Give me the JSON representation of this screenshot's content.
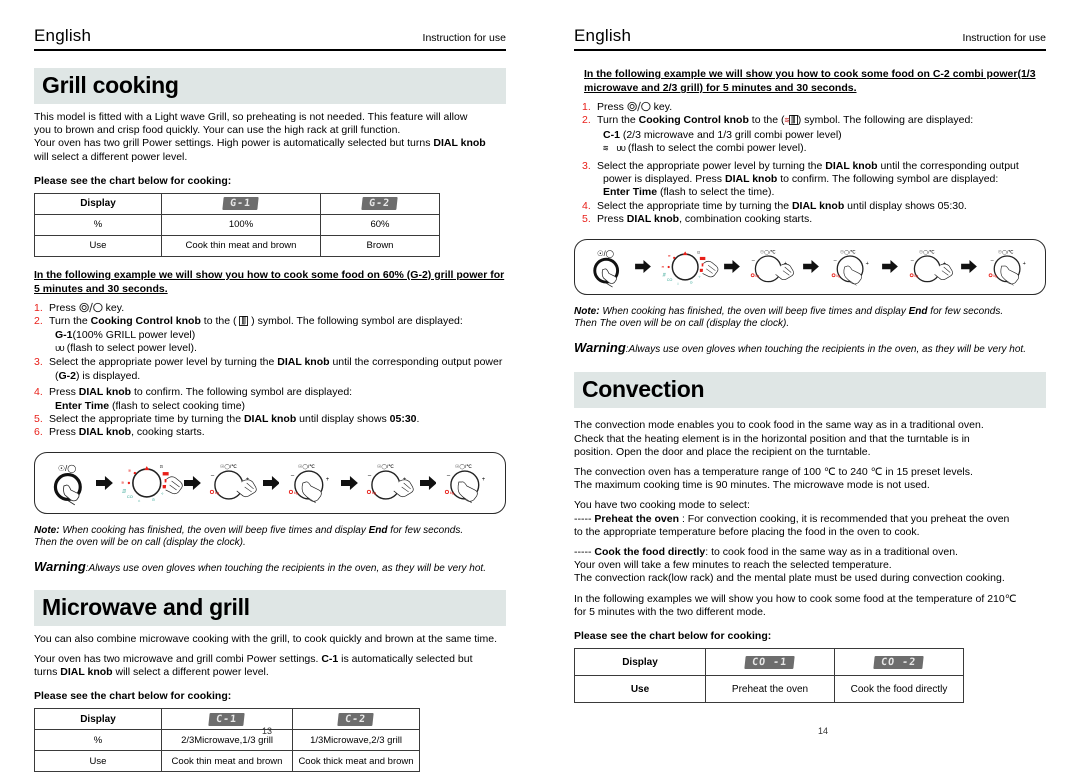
{
  "left_page": {
    "runhead": {
      "language": "English",
      "right": "Instruction for use"
    },
    "section1": {
      "title": "Grill cooking",
      "intro_lines": [
        "This model is fitted with a Light wave Grill, so preheating is not needed. This feature will allow",
        "you to brown and crisp food quickly. Your can use the high rack at grill function.",
        "Your oven has two grill Power settings. High power is automatically selected but turns DIAL knob",
        "will select a different power level."
      ],
      "chart_lead": "Please see the chart below for cooking:",
      "table": {
        "row_labels": [
          "Display",
          "%",
          "Use"
        ],
        "col1": {
          "display": "G-1",
          "percent": "100%",
          "use": "Cook thin meat and brown"
        },
        "col2": {
          "display": "G-2",
          "percent": "60%",
          "use": "Brown"
        }
      },
      "example_heading": "In the following example we will show you how to cook some food on 60% (G-2) grill power for 5 minutes and 30 seconds.",
      "example_heading_line1": "In the following example we  will show you how to  cook some food on 60% (G-2) grill power for",
      "example_heading_line2": "5 minutes and 30 seconds.",
      "steps": [
        {
          "num": "1.",
          "text": "Press  ⊚ / ◯  key."
        },
        {
          "num": "2.",
          "text": "Turn the Cooking Control knob to the  ( ∭ ) symbol. The following symbol are displayed:",
          "sub1": "G-1(100% GRILL power level)",
          "sub2": "ᴜᴜ (flash to select power level)."
        },
        {
          "num": "3.",
          "text": "Select the appropriate power  level by turning the DIAL  knob until the corresponding output power",
          "sub1": "(G-2) is displayed."
        },
        {
          "num": "4.",
          "text": "Press DIAL knob to confirm. The following symbol are  displayed:",
          "sub1": "Enter  Time  (flash to select cooking time)"
        },
        {
          "num": "5.",
          "text": "Select the appropriate time by turning the DIAL knob until display shows 05:30."
        },
        {
          "num": "6.",
          "text": "Press DIAL knob, cooking starts."
        }
      ],
      "note_line1": "Note: When cooking has finished, the  oven will beep five times  and display  End for few seconds.",
      "note_line2": "Then the oven will be  on call (display the clock).",
      "warning_label": "Warning",
      "warning_text": ":Always use oven gloves when  touching the recipients in the  oven, as they will be  very hot."
    },
    "section2": {
      "title": "Microwave and grill",
      "intro1": "You can also combine microwave cooking with the grill, to cook quickly and brown at the same time.",
      "intro2_line1": "Your oven has two microwave and grill combi Power settings. C-1 is automatically selected but",
      "intro2_line2": "turns DIAL knob  will select a different power level.",
      "chart_lead": "Please see the chart below for cooking:",
      "table": {
        "row_labels": [
          "Display",
          "%",
          "Use"
        ],
        "col1": {
          "display": "C-1",
          "percent": "2/3Microwave,1/3 grill",
          "use": "Cook thin meat and brown"
        },
        "col2": {
          "display": "C-2",
          "percent": "1/3Microwave,2/3 grill",
          "use": "Cook thick meat and brown"
        }
      }
    },
    "page_number": "13"
  },
  "right_page": {
    "runhead": {
      "language": "English",
      "right": "Instruction for use"
    },
    "example_heading_line1": "In the following example we will show you how to cook some food on C-2 combi power(1/3",
    "example_heading_line2": "microwave and 2/3 grill) for 5 minutes and 30 seconds.",
    "steps": [
      {
        "num": "1.",
        "text": "Press  ⊚ / ◯  key."
      },
      {
        "num": "2.",
        "text": "Turn the Cooking Control knob to the  ( ≋ ∭ ) symbol. The following  are displayed:",
        "sub1": "C-1 (2/3 microwave and 1/3 grill combi power level)",
        "sub2": "≋    ᴜᴜ (flash to select the combi power level)."
      },
      {
        "num": "3.",
        "text": "Select the appropriate power level by turning the DIAL knob until the corresponding output",
        "sub1": "power is displayed. Press DIAL knob to confirm. The following symbol are displayed:",
        "sub2": "Enter  Time  (flash to select the time)."
      },
      {
        "num": "4.",
        "text": "Select the appropriate time by turning the DIAL knob until display shows 05:30."
      },
      {
        "num": "5.",
        "text": "Press DIAL knob, combination cooking starts."
      }
    ],
    "note_line1": "Note: When cooking has finished, the  oven will beep five times  and display  End for few seconds.",
    "note_line2": "Then The oven will be  on call (display the clock).",
    "warning_label": "Warning",
    "warning_text": ":Always use oven gloves when  touching the recipients in the  oven, as they will be  very hot.",
    "section": {
      "title": "Convection",
      "para1_lines": [
        "The convection mode enables you to cook food in the same way as in a traditional oven.",
        "Check that the heating element is in the horizontal position and that the turntable is in",
        "position. Open the door and place the recipient on the turntable."
      ],
      "para2_lines": [
        "The convection oven has a temperature range of 100 ℃ to 240 ℃ in 15 preset levels.",
        "The maximum cooking time is 90 minutes. The microwave mode is not used."
      ],
      "para3_lines": [
        "You have two cooking mode to select:",
        "----- Preheat the oven : For convection cooking, it is recommended that you preheat the oven",
        "to the appropriate temperature before placing the food in the oven to cook."
      ],
      "para4_lines": [
        "----- Cook the food directly: to cook food in the same way as in a traditional oven.",
        "Your oven will take a few minutes to reach the selected temperature.",
        "The convection rack(low rack) and the mental plate must be used during convection cooking."
      ],
      "para5_lines": [
        "In the following examples we will show you how to cook some food at the temperature of 210℃",
        "for 5 minutes with the two different mode."
      ],
      "chart_lead": "Please see the chart below for cooking:",
      "table": {
        "row_labels": [
          "Display",
          "Use"
        ],
        "col1": {
          "display": "CO -1",
          "use": "Preheat the oven"
        },
        "col2": {
          "display": "CO -2",
          "use": "Cook the food directly"
        }
      }
    },
    "page_number": "14"
  },
  "colors": {
    "banner": "#dfe6e5",
    "step_number": "#e8201a",
    "lcd_background": "#6d6d6d",
    "lcd_text": "#e8e8e8",
    "rule": "#000000"
  },
  "icons": {
    "power_key": "⊚ / ◯",
    "grill_symbol": "∭",
    "microwave_symbol": "≋",
    "flash_wave": "ᴜᴜ"
  }
}
